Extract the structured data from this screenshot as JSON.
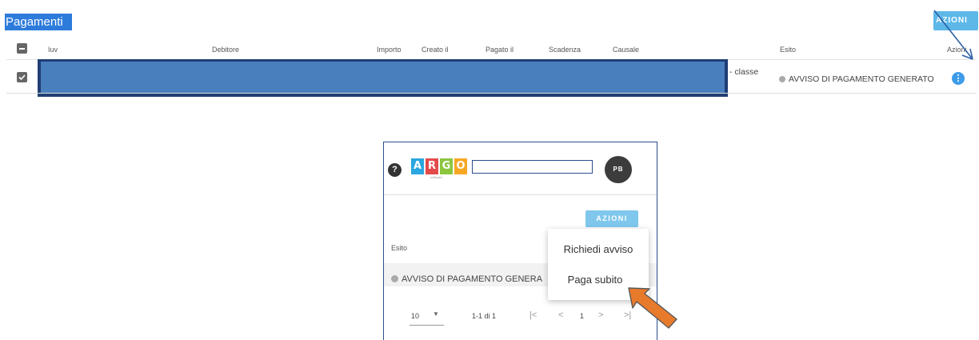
{
  "page": {
    "title": "Pagamenti",
    "azioni_button": "AZIONI"
  },
  "table": {
    "headers": {
      "iuv": "Iuv",
      "debitore": "Debitore",
      "importo": "Importo",
      "creato_il": "Creato il",
      "pagato_il": "Pagato il",
      "scadenza": "Scadenza",
      "causale": "Causale",
      "esito": "Esito",
      "azioni": "Azioni"
    },
    "row": {
      "causale_tail": "- classe",
      "esito": "AVVISO DI PAGAMENTO GENERATO",
      "actions_icon": "info-icon"
    }
  },
  "inset": {
    "help_icon": "?",
    "logo_letters": [
      "A",
      "R",
      "G",
      "O"
    ],
    "logo_colors": [
      "#2aa6e0",
      "#e54a4a",
      "#8cc63f",
      "#f7a823"
    ],
    "logo_subtitle": "software",
    "avatar_initials": "PB",
    "azioni_button": "AZIONI",
    "esito_header": "Esito",
    "esito_value": "AVVISO DI PAGAMENTO GENERA",
    "menu": {
      "items": [
        "Richiedi avviso",
        "Paga subito"
      ]
    },
    "pagination": {
      "page_size": "10",
      "range": "1-1 di 1",
      "current_page": "1",
      "first": "|<",
      "prev": "<",
      "next": ">",
      "last": ">|"
    }
  },
  "annotations": {
    "arrow_color": "#e87a2c",
    "line_color": "#2d5fa8"
  }
}
